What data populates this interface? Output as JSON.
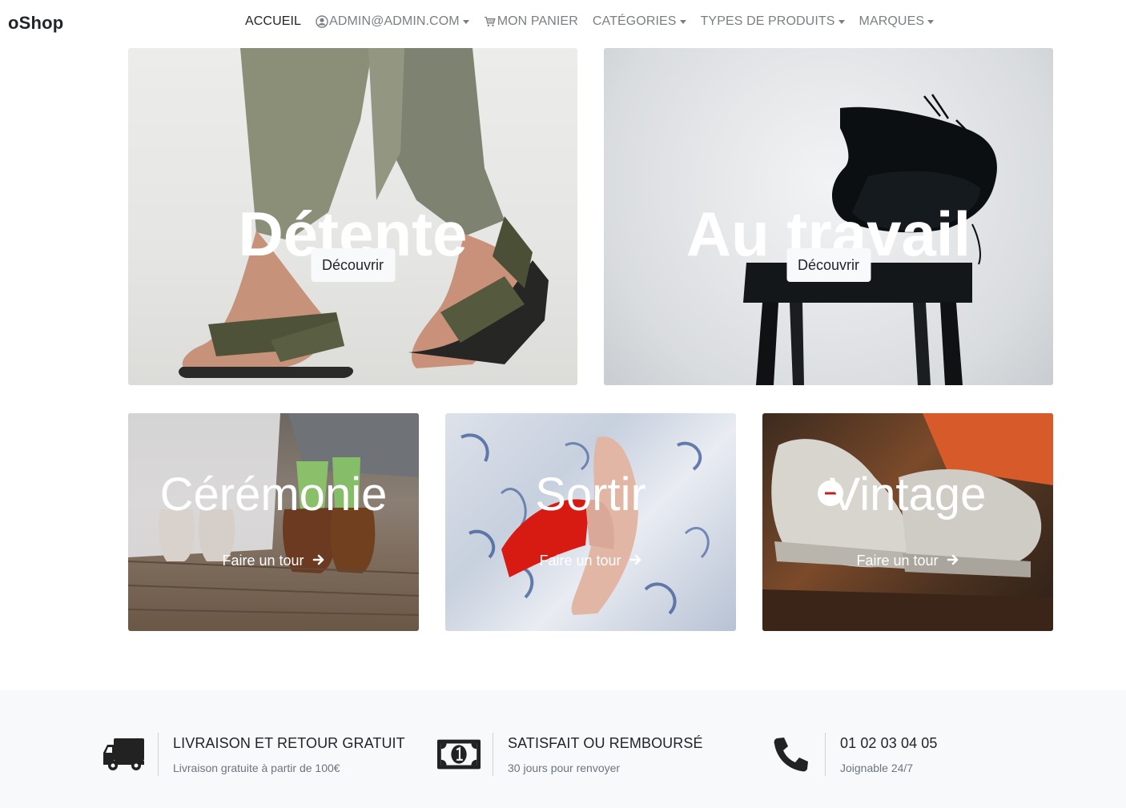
{
  "navbar": {
    "brand": "oShop",
    "items": [
      {
        "label": "Accueil"
      },
      {
        "label": "admin@admin.com"
      },
      {
        "label": "Mon panier"
      },
      {
        "label": "Catégories"
      },
      {
        "label": "Types de produits"
      },
      {
        "label": "Marques"
      }
    ],
    "icons": [
      "user-circle-icon",
      "cart-icon"
    ]
  },
  "hero": [
    {
      "title": "Détente",
      "button": "Découvrir"
    },
    {
      "title": "Au travail",
      "button": "Découvrir"
    }
  ],
  "categories": [
    {
      "title": "Cérémonie",
      "link": "Faire un tour"
    },
    {
      "title": "Sortir",
      "link": "Faire un tour"
    },
    {
      "title": "Vintage",
      "link": "Faire un tour"
    }
  ],
  "features": [
    {
      "icon": "truck-icon",
      "title": "Livraison et retour gratuit",
      "subtitle": "Livraison gratuite à partir de 100€"
    },
    {
      "icon": "money-bill-icon",
      "title": "Satisfait ou remboursé",
      "subtitle": "30 jours pour renvoyer"
    },
    {
      "icon": "phone-icon",
      "title": "01 02 03 04 05",
      "subtitle": "Joignable 24/7"
    }
  ],
  "colors": {
    "text": "#212529",
    "muted": "#6c757d",
    "nav_inactive": "#7a7f84",
    "feature_bg": "#f8f9fa",
    "button_bg": "#f8f9fa"
  }
}
